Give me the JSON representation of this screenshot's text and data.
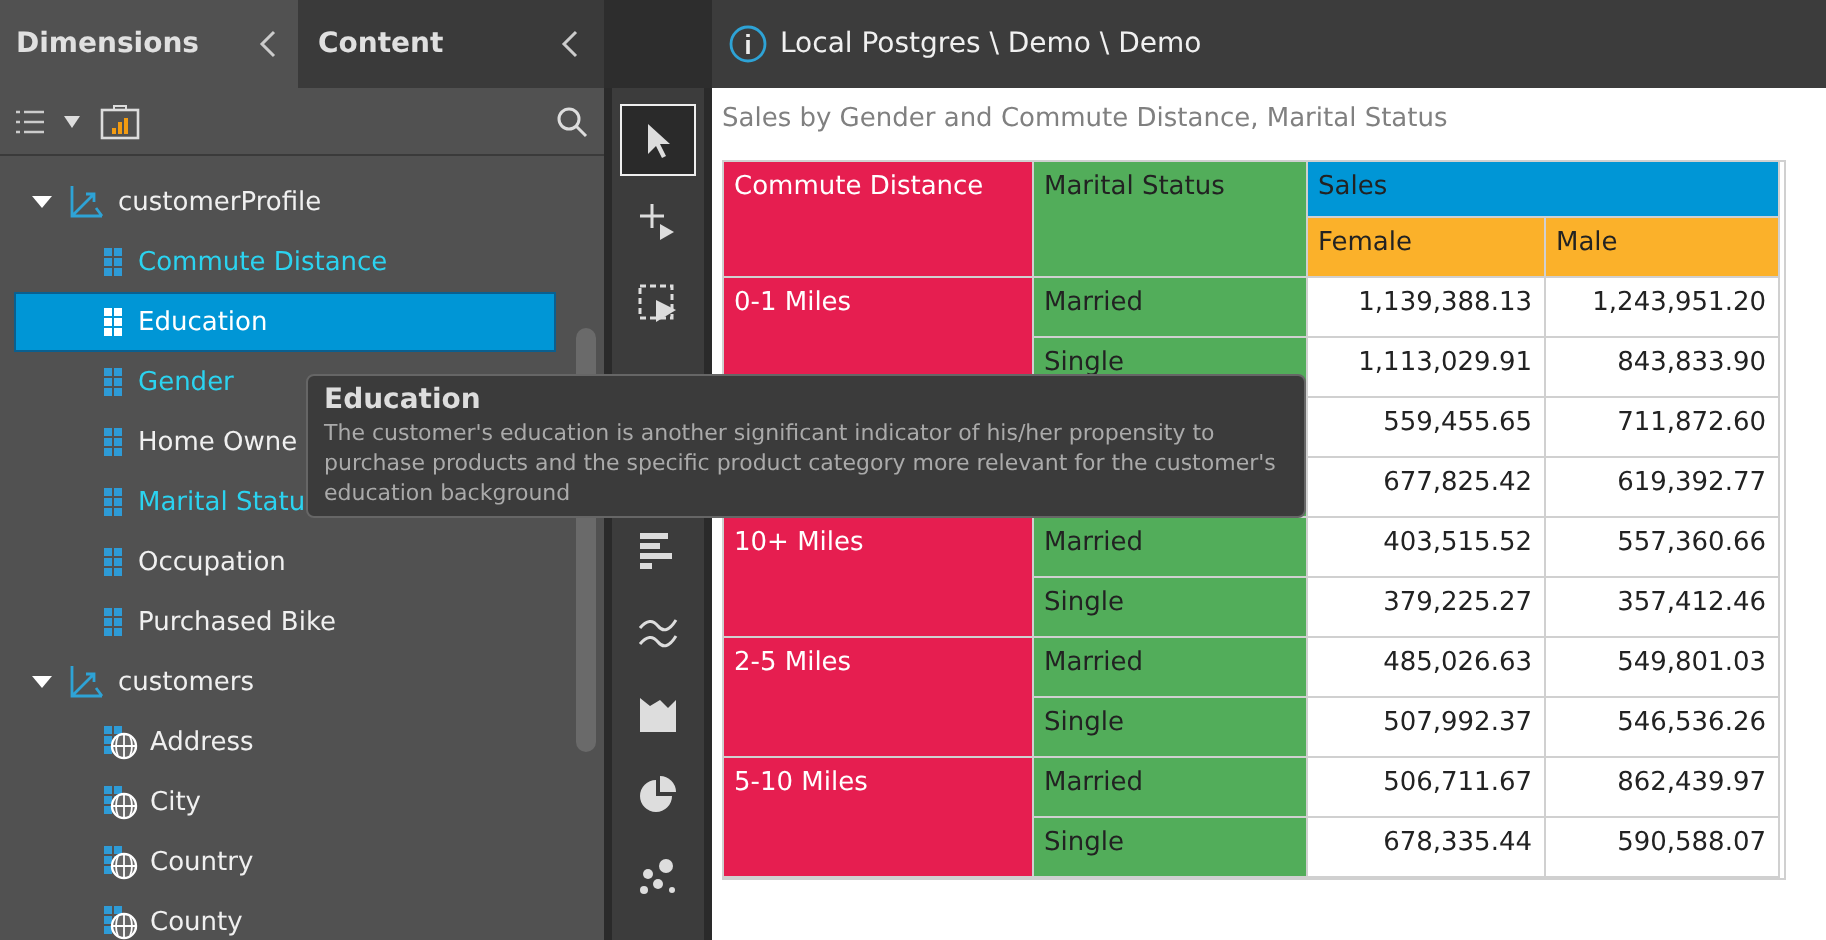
{
  "panel_tabs": [
    {
      "label": "Dimensions",
      "selected": true
    },
    {
      "label": "Content",
      "selected": false
    }
  ],
  "breadcrumb": "Local Postgres \\ Demo \\ Demo",
  "tree": [
    {
      "label": "customerProfile",
      "expanded": true,
      "children": [
        {
          "label": "Commute Distance",
          "kind": "attribute",
          "used": true,
          "selected": false
        },
        {
          "label": "Education",
          "kind": "attribute",
          "used": false,
          "selected": true
        },
        {
          "label": "Gender",
          "kind": "attribute",
          "used": true,
          "selected": false
        },
        {
          "label": "Home Owne",
          "kind": "attribute",
          "used": false,
          "selected": false
        },
        {
          "label": "Marital Statu",
          "kind": "attribute",
          "used": true,
          "selected": false
        },
        {
          "label": "Occupation",
          "kind": "attribute",
          "used": false,
          "selected": false
        },
        {
          "label": "Purchased Bike",
          "kind": "attribute",
          "used": false,
          "selected": false
        }
      ]
    },
    {
      "label": "customers",
      "expanded": true,
      "children": [
        {
          "label": "Address",
          "kind": "geo",
          "used": false,
          "selected": false
        },
        {
          "label": "City",
          "kind": "geo",
          "used": false,
          "selected": false
        },
        {
          "label": "Country",
          "kind": "geo",
          "used": false,
          "selected": false
        },
        {
          "label": "County",
          "kind": "geo",
          "used": false,
          "selected": false
        }
      ]
    }
  ],
  "tools_top": [
    {
      "kind": "pointer",
      "selected": true
    },
    {
      "kind": "add",
      "selected": false
    },
    {
      "kind": "marquee",
      "selected": false
    }
  ],
  "tools_bottom": [
    {
      "kind": "bars",
      "selected": false
    },
    {
      "kind": "lines",
      "selected": false
    },
    {
      "kind": "area",
      "selected": false
    },
    {
      "kind": "pie",
      "selected": false
    },
    {
      "kind": "scatter",
      "selected": false
    }
  ],
  "tooltip": {
    "title": "Education",
    "text": "The customer's education is another significant indicator of his/her propensity to purchase products and the specific product category more relevant for the customer's education background"
  },
  "report": {
    "title": "Sales by Gender and Commute Distance, Marital Status",
    "headers": {
      "row_1": "Commute Distance",
      "row_2": "Marital Status",
      "measure": "Sales",
      "columns": [
        "Female",
        "Male"
      ]
    },
    "groups": [
      {
        "label": "0-1 Miles",
        "rows": [
          {
            "label": "Married",
            "values": [
              "1,139,388.13",
              "1,243,951.20"
            ]
          },
          {
            "label": "Single",
            "values": [
              "1,113,029.91",
              "843,833.90"
            ]
          }
        ]
      },
      {
        "rows": [
          {
            "values": [
              "559,455.65",
              "711,872.60"
            ]
          },
          {
            "values": [
              "677,825.42",
              "619,392.77"
            ]
          }
        ]
      },
      {
        "label": "10+ Miles",
        "rows": [
          {
            "label": "Married",
            "values": [
              "403,515.52",
              "557,360.66"
            ]
          },
          {
            "label": "Single",
            "values": [
              "379,225.27",
              "357,412.46"
            ]
          }
        ]
      },
      {
        "label": "2-5 Miles",
        "rows": [
          {
            "label": "Married",
            "values": [
              "485,026.63",
              "549,801.03"
            ]
          },
          {
            "label": "Single",
            "values": [
              "507,992.37",
              "546,536.26"
            ]
          }
        ]
      },
      {
        "label": "5-10 Miles",
        "rows": [
          {
            "label": "Married",
            "values": [
              "506,711.67",
              "862,439.97"
            ]
          },
          {
            "label": "Single",
            "values": [
              "678,335.44",
              "590,588.07"
            ]
          }
        ]
      }
    ]
  }
}
